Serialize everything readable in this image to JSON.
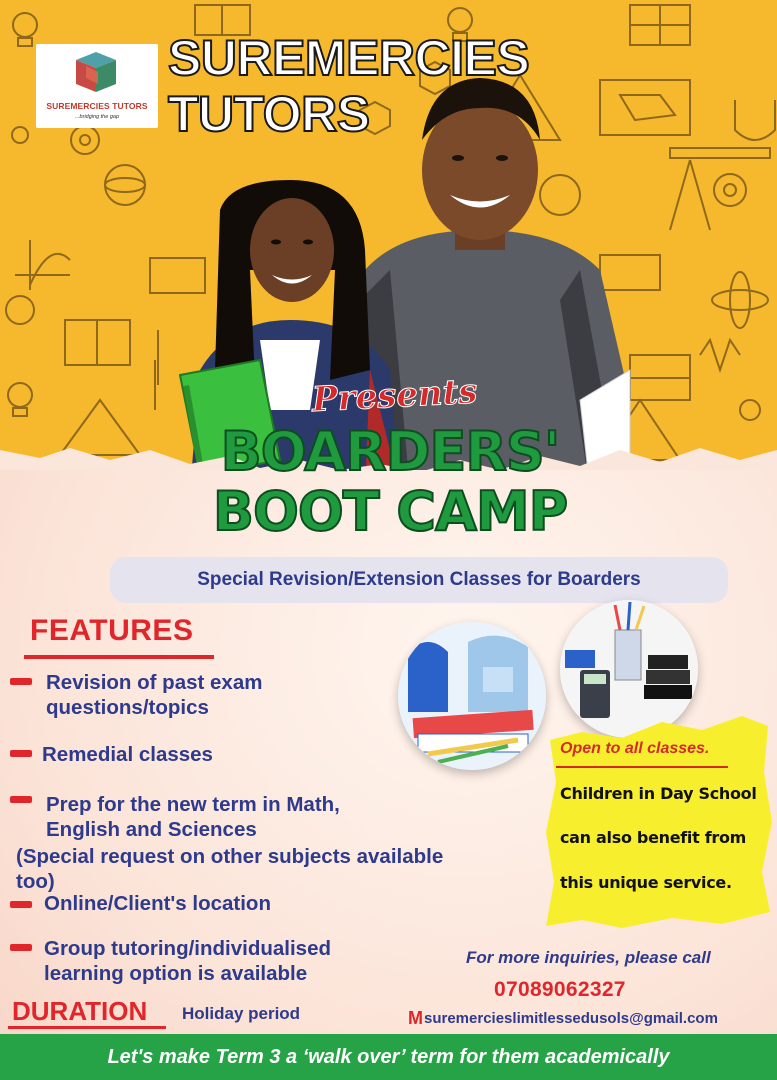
{
  "brand": {
    "logo_name": "SUREMERCIES TUTORS",
    "logo_tagline": "...bridging the gap",
    "title_line1": "SUREMERCIES",
    "title_line2": "TUTORS"
  },
  "headline": {
    "presents": "Presents",
    "line1": "BOARDERS'",
    "line2": "BOOT CAMP"
  },
  "subtitle": "Special Revision/Extension Classes for Boarders",
  "features": {
    "title": "FEATURES",
    "items": [
      {
        "line1": "Revision of past exam",
        "line2": "questions/topics"
      },
      {
        "line1": "Remedial classes"
      },
      {
        "line1": "Prep for the new term in Math,",
        "line2": "English and Sciences",
        "note": "(Special request on other subjects available too)"
      },
      {
        "line1": "Online/Client's location"
      },
      {
        "line1": "Group tutoring/individualised",
        "line2": "learning option is available"
      }
    ]
  },
  "note": {
    "title": "Open to all classes.",
    "line1": "Children in Day School",
    "line2": "can also benefit from",
    "line3": "this unique service."
  },
  "contact": {
    "inquiry": "For more inquiries, please call",
    "phone": "07089062327",
    "email_icon": "M",
    "email": "suremercieslimitlessedusols@gmail.com"
  },
  "duration": {
    "title": "DURATION",
    "value": "Holiday period"
  },
  "footer": "Let's make Term 3 a ‘walk over’ term for them academically",
  "colors": {
    "yellow": "#f6b82c",
    "green": "#1f9a3f",
    "red": "#e0262b",
    "navy": "#2e3a8c",
    "footer_green": "#27a347"
  }
}
